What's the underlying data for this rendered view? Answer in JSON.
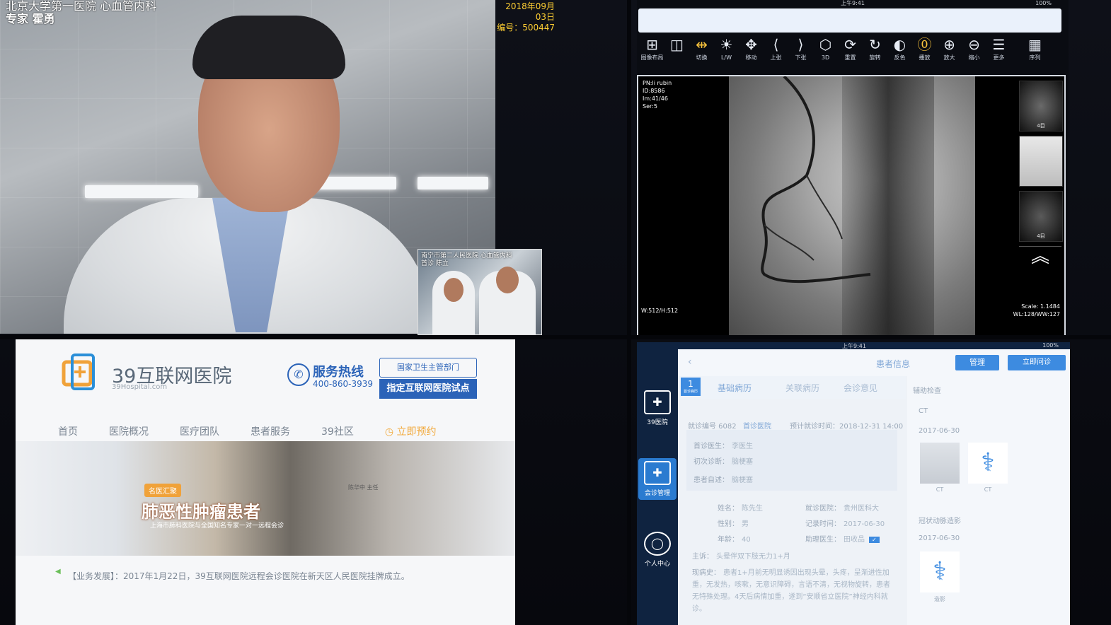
{
  "video_main": {
    "hospital_caption": "北京大学第一医院 心血管内科",
    "expert_caption": "专家 霍勇",
    "date": "2018年09月03日",
    "serial": "编号：500447"
  },
  "video_pip": {
    "caption_line1": "南宁市第二人民医院 心血管内科",
    "caption_line2": "首诊 陈立"
  },
  "pacs": {
    "status_time": "上午9:41",
    "status_battery": "100%",
    "toolbar": [
      {
        "icon": "grid-icon",
        "glyph": "⊞",
        "label": "图像布局",
        "active": false
      },
      {
        "icon": "split-icon",
        "glyph": "◫",
        "label": "",
        "active": false
      },
      {
        "icon": "switch-arrows-icon",
        "glyph": "⇹",
        "label": "切换",
        "active": true
      },
      {
        "icon": "brightness-icon",
        "glyph": "☀",
        "label": "L/W",
        "active": false
      },
      {
        "icon": "move-icon",
        "glyph": "✥",
        "label": "移动",
        "active": false
      },
      {
        "icon": "prev-icon",
        "glyph": "⟨",
        "label": "上张",
        "active": false
      },
      {
        "icon": "next-icon",
        "glyph": "⟩",
        "label": "下张",
        "active": false
      },
      {
        "icon": "cube-3d-icon",
        "glyph": "⬡",
        "label": "3D",
        "active": false
      },
      {
        "icon": "reset-icon",
        "glyph": "⟳",
        "label": "重置",
        "active": false
      },
      {
        "icon": "rotate-icon",
        "glyph": "↻",
        "label": "旋转",
        "active": false
      },
      {
        "icon": "invert-icon",
        "glyph": "◐",
        "label": "反色",
        "active": false
      },
      {
        "icon": "play-icon",
        "glyph": "⓪",
        "label": "播放",
        "active": true
      },
      {
        "icon": "zoom-in-icon",
        "glyph": "⊕",
        "label": "放大",
        "active": false
      },
      {
        "icon": "zoom-out-icon",
        "glyph": "⊖",
        "label": "缩小",
        "active": false
      },
      {
        "icon": "menu-icon",
        "glyph": "☰",
        "label": "更多",
        "active": false
      },
      {
        "icon": "film-icon",
        "glyph": "▦",
        "label": "序列",
        "active": false
      }
    ],
    "info_top_left": [
      "PN:li rubin",
      "ID:8586",
      "Im:41/46",
      "Ser:5"
    ],
    "info_bottom_left": "W:512/H:512",
    "info_bottom_right": [
      "Scale: 1.1484",
      "WL:128/WW:127"
    ],
    "thumb_labels": [
      "4目",
      "",
      "4目"
    ]
  },
  "website": {
    "name": "39互联网医院",
    "domain": "39Hospital.com",
    "hotline_title": "服务热线",
    "hotline_number": "400-860-3939",
    "badge_top": "国家卫生主管部门",
    "badge_bottom": "指定互联网医院试点",
    "nav": [
      "首页",
      "医院概况",
      "医疗团队",
      "患者服务",
      "39社区"
    ],
    "nav_book": "立即预约",
    "banner_tag": "名医汇聚",
    "banner_title": "肺恶性肿瘤患者",
    "banner_sub": "上海市肺科医院与全国知名专家一对一远程会诊",
    "banner_doctor": "陈华中 主任",
    "news": "【业务发展】：2017年1月22日，39互联网医院远程会诊医院在新天区人民医院挂牌成立。"
  },
  "emr": {
    "status_time": "上午9:41",
    "status_battery": "100%",
    "title": "患者信息",
    "btn_manage": "管理",
    "btn_consult": "立即问诊",
    "side": [
      {
        "icon": "hospital-icon",
        "glyph": "✚",
        "label": "39医院"
      },
      {
        "icon": "folder-icon",
        "glyph": "✚",
        "label": "会诊管理"
      },
      {
        "icon": "user-icon",
        "glyph": "◯",
        "label": "个人中心"
      }
    ],
    "tab_badge": "1",
    "tab_badge_sub": "首诊病历",
    "tabs": [
      "基础病历",
      "关联病历",
      "会诊意见"
    ],
    "visit_no": "就诊编号 6082",
    "visit_tag": "首诊医院",
    "visit_time": "预计就诊时间：2018-12-31 14:00",
    "first_doctor_label": "首诊医生：",
    "first_doctor": "李医生",
    "first_diag_label": "初次诊断：",
    "first_diag": "脑梗塞",
    "self_report_label": "患者自述：",
    "self_report": "脑梗塞",
    "name_label": "姓名：",
    "name": "陈先生",
    "hospital_label": "就诊医院：",
    "hospital": "贵州医科大",
    "gender_label": "性别：",
    "gender": "男",
    "record_time_label": "记录时间：",
    "record_time": "2017-06-30",
    "age_label": "年龄：",
    "age": "40",
    "assistant_label": "助理医生：",
    "assistant": "田收品",
    "complaint_label": "主诉：",
    "complaint": "头晕伴双下肢无力1+月",
    "history_label": "现病史：",
    "history": "患者1+月前无明显诱因出现头晕，头疼，呈渐进性加重，无发热，咳嗽，无意识障碍，言语不清，无视物旋转，患者无特殊处理。4天后病情加重，遂到“安顺省立医院”神经内科就诊。",
    "right_header": "辅助检查",
    "right_sec1": "CT",
    "right_date1": "2017-06-30",
    "file_labels1": [
      "CT",
      "CT"
    ],
    "right_sec2": "冠状动脉造影",
    "right_date2": "2017-06-30",
    "file_labels2": [
      "造影"
    ]
  }
}
